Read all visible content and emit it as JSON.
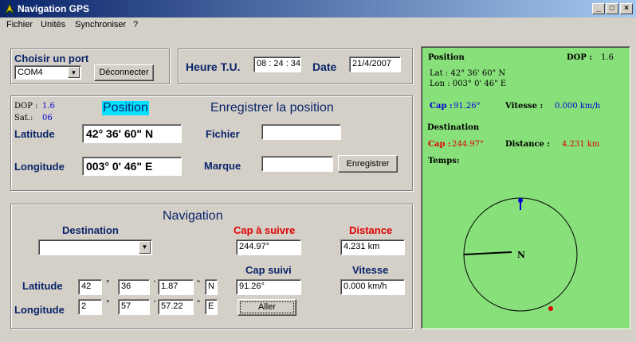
{
  "window": {
    "title": "Navigation GPS"
  },
  "menu": [
    "Fichier",
    "Unités",
    "Synchroniser",
    "?"
  ],
  "port": {
    "title": "Choisir un port",
    "selected": "COM4",
    "disconnect_label": "Déconnecter"
  },
  "time": {
    "utc_label": "Heure T.U.",
    "utc_value": "08 : 24 : 34",
    "date_label": "Date",
    "date_value": "21/4/2007"
  },
  "position": {
    "dop_label": "DOP :",
    "dop_value": "1.6",
    "sat_label": "Sat.:",
    "sat_value": "06",
    "title": "Position",
    "lat_label": "Latitude",
    "lat_value": "42° 36' 60\" N",
    "lon_label": "Longitude",
    "lon_value": "003° 0' 46\" E"
  },
  "record": {
    "title": "Enregistrer la position",
    "file_label": "Fichier",
    "file_value": "",
    "mark_label": "Marque",
    "mark_value": "",
    "save_label": "Enregistrer"
  },
  "navigation": {
    "title": "Navigation",
    "destination_label": "Destination",
    "destination_value": "",
    "cap_follow_label": "Cap  à suivre",
    "cap_follow_value": "244.97°",
    "distance_label": "Distance",
    "distance_value": "4.231 km",
    "cap_followed_label": "Cap suivi",
    "cap_followed_value": "91.26°",
    "speed_label": "Vitesse",
    "speed_value": "0.000 km/h",
    "lat_label": "Latitude",
    "lat_deg": "42",
    "lat_min": "36",
    "lat_sec": "1.87",
    "lat_hem": "N",
    "lon_label": "Longitude",
    "lon_deg": "2",
    "lon_min": "57",
    "lon_sec": "57.22",
    "lon_hem": "E",
    "deg_sym": "°",
    "min_sym": "'",
    "sec_sym": "\"",
    "go_label": "Aller"
  },
  "panel": {
    "position_title": "Position",
    "dop_label": "DOP :",
    "dop_value": "1.6",
    "lat_line": "Lat : 42° 36' 60\" N",
    "lon_line": "Lon : 003° 0' 46\" E",
    "cap_label": "Cap :",
    "cap_value": "91.26°",
    "speed_label": "Vitesse :",
    "speed_value": "0.000 km/h",
    "destination_title": "Destination",
    "dest_cap_label": "Cap :",
    "dest_cap_value": "244.97°",
    "distance_label": "Distance :",
    "distance_value": "4.231 km",
    "time_label": "Temps:",
    "north_label": "N"
  },
  "colors": {
    "panel_bg": "#88e07a",
    "title_blue": "#0a246a",
    "red": "#e00000",
    "highlight": "#00e0ff"
  }
}
